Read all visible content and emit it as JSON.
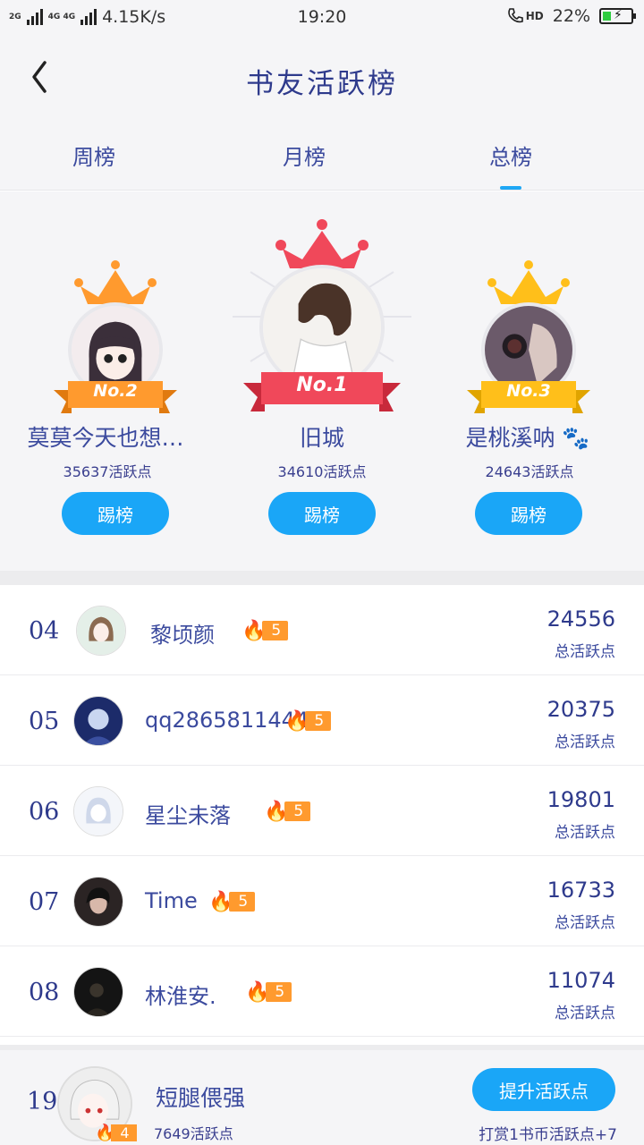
{
  "status_bar": {
    "net_label": "2G",
    "net_label2": "4G 4G",
    "speed": "4.15K/s",
    "time": "19:20",
    "hd": "HD",
    "battery_pct": "22%",
    "battery_level": 0.22
  },
  "header": {
    "title": "书友活跃榜",
    "tabs": [
      {
        "label": "周榜",
        "active": false
      },
      {
        "label": "月榜",
        "active": false
      },
      {
        "label": "总榜",
        "active": true
      }
    ]
  },
  "podium": [
    {
      "rank": "No.2",
      "name": "莫莫今天也想…",
      "points": "35637活跃点",
      "button": "踢榜"
    },
    {
      "rank": "No.1",
      "name": "旧城",
      "points": "34610活跃点",
      "button": "踢榜"
    },
    {
      "rank": "No.3",
      "name": "是桃溪呐",
      "points": "24643活跃点",
      "button": "踢榜"
    }
  ],
  "list": [
    {
      "rank": "04",
      "name": "黎顷颜",
      "level": "5",
      "score": "24556",
      "unit": "总活跃点"
    },
    {
      "rank": "05",
      "name": "qq2865811444",
      "level": "5",
      "score": "20375",
      "unit": "总活跃点"
    },
    {
      "rank": "06",
      "name": "星尘未落",
      "level": "5",
      "score": "19801",
      "unit": "总活跃点"
    },
    {
      "rank": "07",
      "name": "Time",
      "level": "5",
      "score": "16733",
      "unit": "总活跃点"
    },
    {
      "rank": "08",
      "name": "林淮安.",
      "level": "5",
      "score": "11074",
      "unit": "总活跃点"
    }
  ],
  "mine": {
    "rank": "19",
    "name": "短腿偎强",
    "level": "4",
    "points": "7649活跃点",
    "button": "提升活跃点",
    "hint": "打赏1书币活跃点+7"
  },
  "colors": {
    "accent": "#1aa6f7",
    "text": "#3b4a9e",
    "gold": "#ffbf1a",
    "silver_orange": "#ff9a2e",
    "red": "#f0485a"
  }
}
